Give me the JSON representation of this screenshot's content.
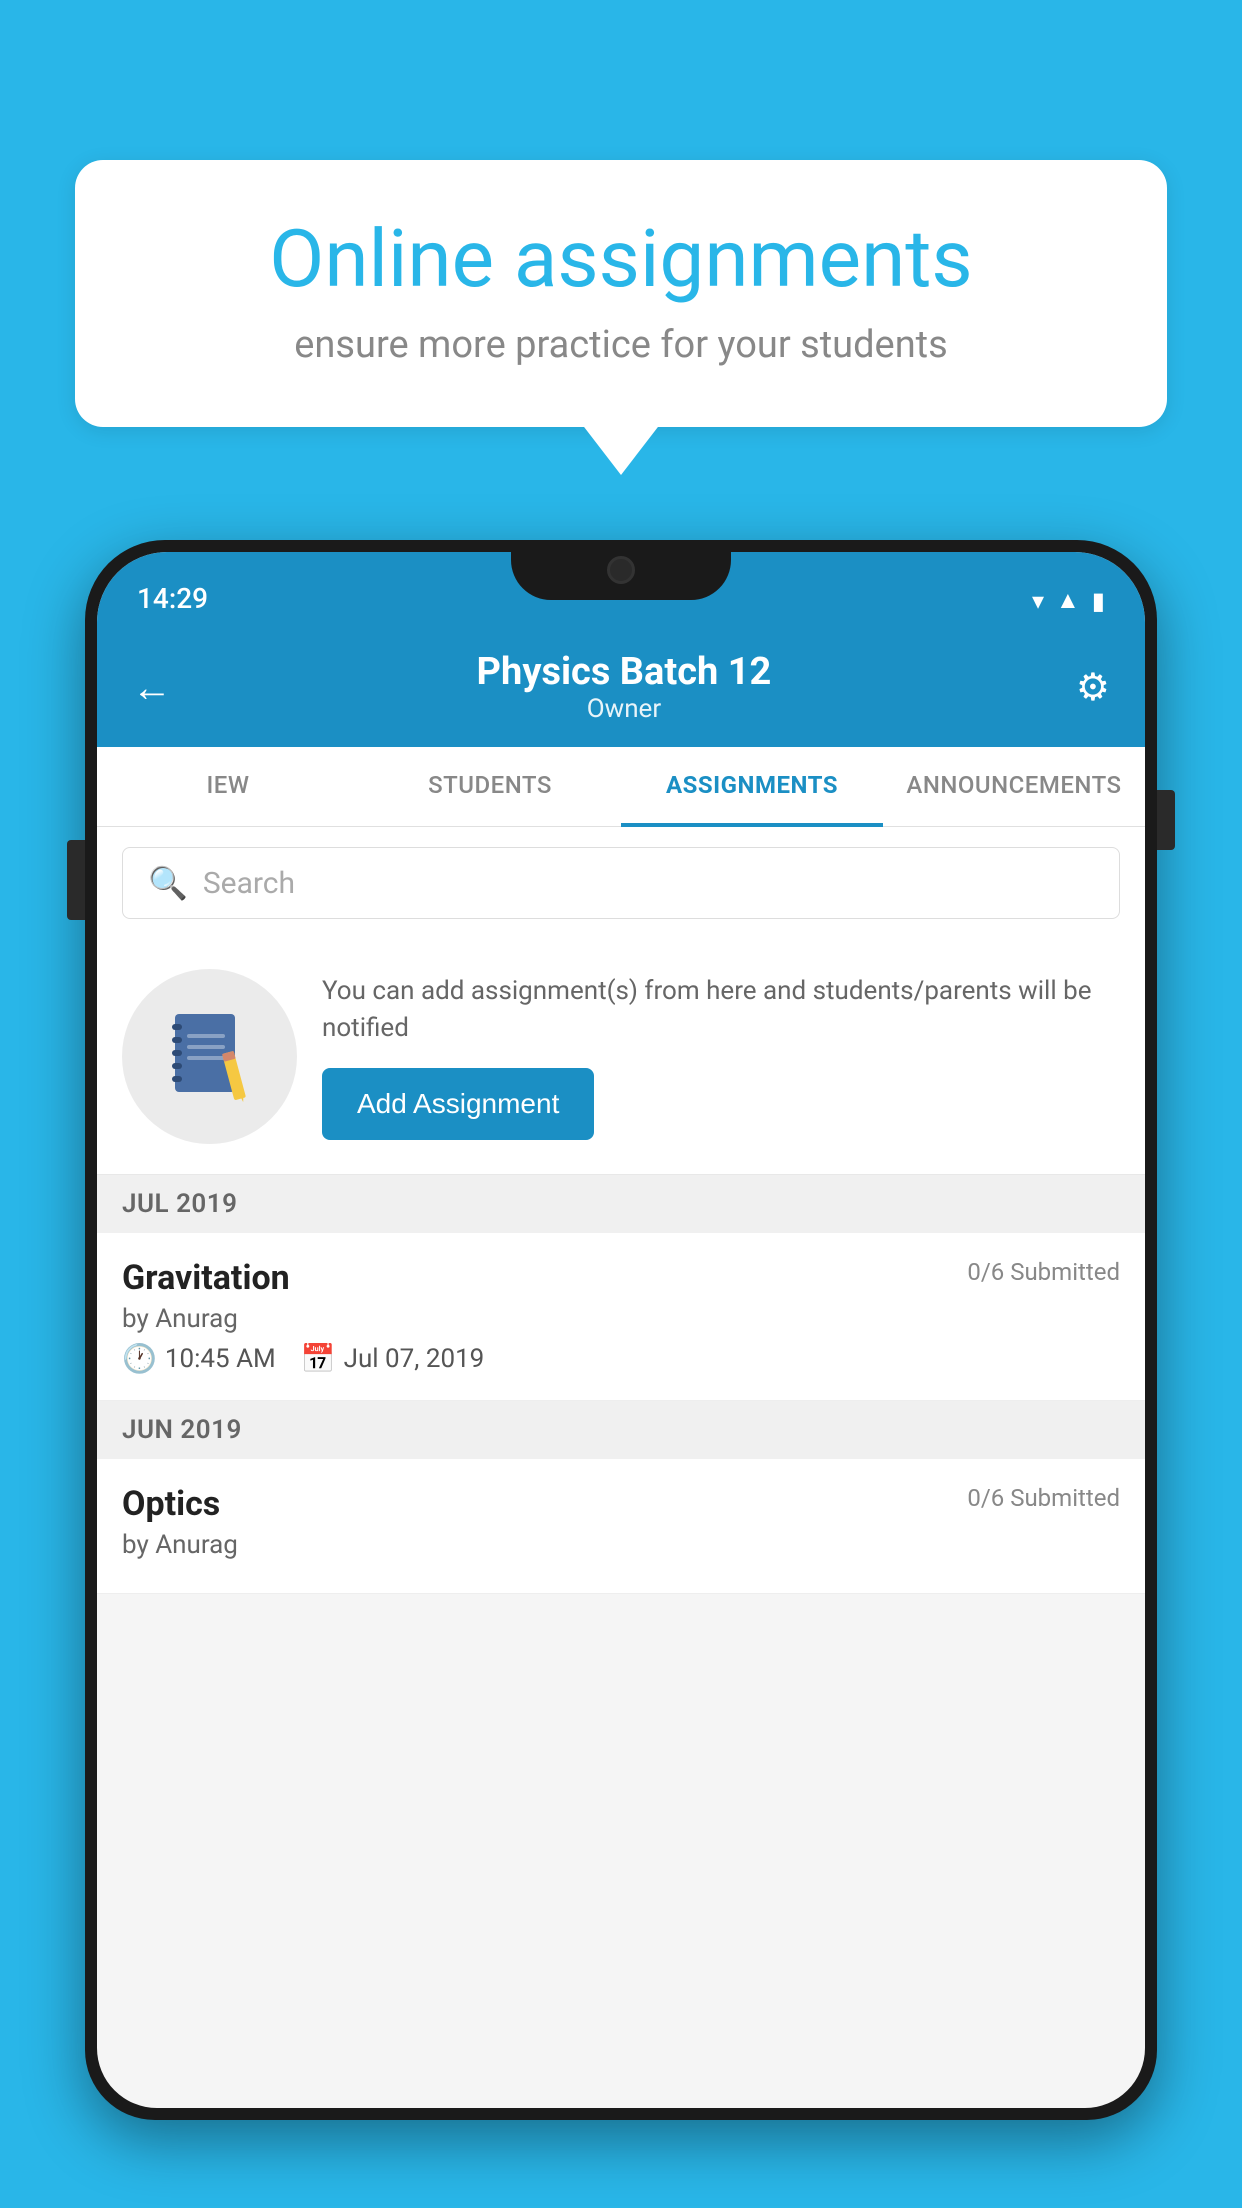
{
  "background_color": "#29b6e8",
  "bubble": {
    "title": "Online assignments",
    "subtitle": "ensure more practice for your students"
  },
  "status_bar": {
    "time": "14:29",
    "icons": [
      "wifi",
      "signal",
      "battery"
    ]
  },
  "header": {
    "title": "Physics Batch 12",
    "subtitle": "Owner",
    "back_label": "←",
    "settings_label": "⚙"
  },
  "tabs": [
    {
      "label": "IEW",
      "active": false
    },
    {
      "label": "STUDENTS",
      "active": false
    },
    {
      "label": "ASSIGNMENTS",
      "active": true
    },
    {
      "label": "ANNOUNCEMENTS",
      "active": false
    }
  ],
  "search": {
    "placeholder": "Search"
  },
  "promo": {
    "description": "You can add assignment(s) from here and students/parents will be notified",
    "button_label": "Add Assignment"
  },
  "sections": [
    {
      "month": "JUL 2019",
      "assignments": [
        {
          "name": "Gravitation",
          "submitted": "0/6 Submitted",
          "by": "by Anurag",
          "time": "10:45 AM",
          "date": "Jul 07, 2019"
        }
      ]
    },
    {
      "month": "JUN 2019",
      "assignments": [
        {
          "name": "Optics",
          "submitted": "0/6 Submitted",
          "by": "by Anurag",
          "time": "",
          "date": ""
        }
      ]
    }
  ]
}
